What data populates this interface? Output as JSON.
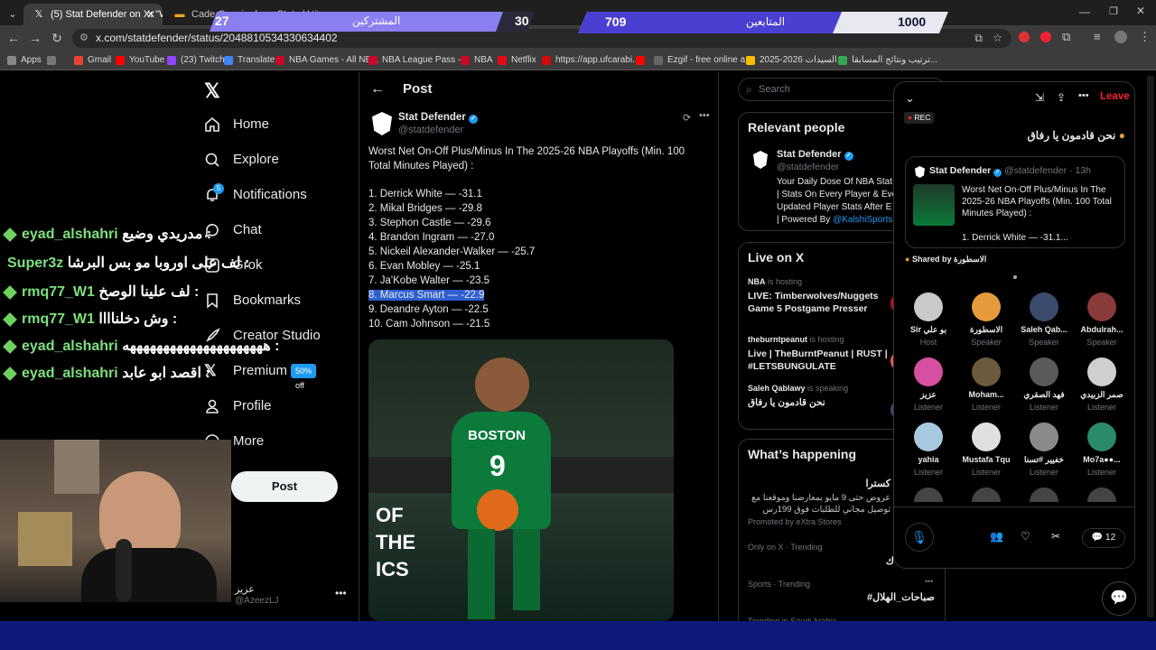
{
  "browser": {
    "tabs": [
      {
        "title": "(5) Stat Defender on X: \"Wo",
        "active": true
      },
      {
        "title": "Cade Cunningham Stats Using...",
        "active": false
      }
    ],
    "url": "x.com/statdefender/status/2048810534330634402",
    "bookmarks": [
      "Apps",
      "Gmail",
      "YouTube",
      "(23) Twitch",
      "Translate",
      "NBA Games - All NB...",
      "NBA League Pass -...",
      "NBA",
      "Netflix",
      "https://app.ufcarabi...",
      "Ezgif - free online a...",
      "السيدات 2026-2025...",
      "ترتيب ونتائج المسابقا..."
    ]
  },
  "overlay": {
    "subs_label": "المشتركين",
    "subs_current": "27",
    "subs_goal": "30",
    "followers_label": "المتابعين",
    "followers_current": "709",
    "followers_goal": "1000"
  },
  "chat": [
    {
      "user": "eyad_alshahri",
      "msg": "مدريدي وضيع :",
      "diamond": true
    },
    {
      "user": "Super3z",
      "msg": "لف على اوروبا مو بس البرشا :",
      "diamond": false
    },
    {
      "user": "rmq77_W1",
      "msg": "لف علينا الوصخ :",
      "diamond": true
    },
    {
      "user": "rmq77_W1",
      "msg": "وش دخلناااا :",
      "diamond": true
    },
    {
      "user": "eyad_alshahri",
      "msg": "هههههههههههههههههههههه :",
      "diamond": true
    },
    {
      "user": "eyad_alshahri",
      "msg": "اقصد ابو عابد :",
      "diamond": true
    }
  ],
  "sidebar": {
    "items": [
      {
        "label": "Home",
        "icon": "home-icon"
      },
      {
        "label": "Explore",
        "icon": "search-icon"
      },
      {
        "label": "Notifications",
        "icon": "bell-icon",
        "badge": "5"
      },
      {
        "label": "Chat",
        "icon": "chat-icon"
      },
      {
        "label": "Grok",
        "icon": "grok-icon"
      },
      {
        "label": "Bookmarks",
        "icon": "bookmark-icon"
      },
      {
        "label": "Creator Studio",
        "icon": "rocket-icon"
      },
      {
        "label": "Premium",
        "icon": "x-icon"
      },
      {
        "label": "Profile",
        "icon": "user-icon"
      },
      {
        "label": "More",
        "icon": "more-icon"
      }
    ],
    "premium_badge": "50% off",
    "post_label": "Post",
    "account_name": "عزيز",
    "account_handle": "@AzeezLJ"
  },
  "main": {
    "header": "Post",
    "author_name": "Stat Defender",
    "author_handle": "@statdefender",
    "tweet_title": "Worst Net On-Off Plus/Minus In The 2025-26 NBA Playoffs (Min. 100 Total Minutes Played) :",
    "list": [
      "1.  Derrick White  —  -31.1",
      "2.  Mikal Bridges  —  -29.8",
      "3.  Stephon Castle  —  -29.6",
      "4.  Brandon Ingram  —  -27.0",
      "5.  Nickeil Alexander-Walker  —  -25.7",
      "6.  Evan Mobley  —  -25.1",
      "7.  Ja'Kobe Walter  —  -23.5",
      "8.  Marcus Smart  —  -22.9",
      "9.  Deandre Ayton  —  -22.5",
      "10.  Cam Johnson  —  -21.5"
    ],
    "highlighted_index": 7,
    "jersey_text": "BOSTON",
    "jersey_number": "9"
  },
  "right": {
    "search_placeholder": "Search",
    "relevant_title": "Relevant people",
    "rp_name": "Stat Defender",
    "rp_handle": "@statdefender",
    "rp_bio_1": "Your Daily Dose Of NBA Stat",
    "rp_bio_2": "| Stats On Every Player & Eve",
    "rp_bio_3": "Updated Player Stats After E",
    "rp_bio_4": "| Powered By",
    "rp_bio_link": "@KalshiSports",
    "live_title": "Live on X",
    "live": [
      {
        "host": "NBA",
        "status": "is hosting",
        "title": "LIVE: Timberwolves/Nuggets Game 5 Postgame Presser"
      },
      {
        "host": "theburntpeanut",
        "status": "is hosting",
        "title": "Live | TheBurntPeanut | RUST | #LETSBUNGULATE"
      },
      {
        "host": "Saleh Qablawy",
        "status": "is speaking",
        "title": "نحن قادمون يا رفاق"
      }
    ],
    "happening_title": "What’s happening",
    "trend1_name": "كسترا",
    "trend1_desc_1": "عروض حتى 9 مايو بمعارضنا وموقعنا مع",
    "trend1_desc_2": "توصيل مجاني للطلبات فوق 199رس",
    "trend1_promo": "Promoted by eXtra Stores",
    "trend2_ctx": "Only on X · Trending",
    "trend2_name": "ك",
    "trend3_ctx": "Sports · Trending",
    "trend3_name": "#صباحات_الهلال",
    "trend4_ctx": "Trending in Saudi Arabia"
  },
  "space": {
    "leave": "Leave",
    "rec": "REC",
    "title": "نحن قادمون يا رفاق",
    "q_name": "Stat Defender",
    "q_handle": "@statdefender · 13h",
    "q_text": "Worst Net On-Off Plus/Minus In The 2025-26 NBA Playoffs (Min. 100 Total Minutes Played) :",
    "q_item": "1.  Derrick White  —  -31.1...",
    "shared_by": "Shared by",
    "shared_name": "الاسطورة",
    "people": [
      {
        "name": "Sir بو علي",
        "role": "Host",
        "color": "#c9c9c9"
      },
      {
        "name": "الاسطورة",
        "role": "Speaker",
        "color": "#e59a3c"
      },
      {
        "name": "Saleh Qab...",
        "role": "Speaker",
        "color": "#3c4a6e"
      },
      {
        "name": "Abdulrah...",
        "role": "Speaker",
        "color": "#8a3a3a"
      },
      {
        "name": "عزيز",
        "role": "Listener",
        "color": "#d64fa0"
      },
      {
        "name": "Moham...",
        "role": "Listener",
        "color": "#6b5a3c"
      },
      {
        "name": "فهد الصقري",
        "role": "Listener",
        "color": "#5a5a5a"
      },
      {
        "name": "صمر الزبيدي",
        "role": "Listener",
        "color": "#cfcfcf"
      },
      {
        "name": "yahia",
        "role": "Listener",
        "color": "#a8c8e0"
      },
      {
        "name": "Mustafa Tqu",
        "role": "Listener",
        "color": "#e0e0e0"
      },
      {
        "name": "خفيير #تسنا",
        "role": "Listener",
        "color": "#8a8a8a"
      },
      {
        "name": "Mo7a●●...",
        "role": "Listener",
        "color": "#2a8a6a"
      }
    ],
    "reply_count": "12"
  },
  "colors": {
    "accent": "#1d9bf0",
    "leave": "#f4212e",
    "chat_green": "#6dd35e",
    "overlay_purple": "#6b5ce7"
  }
}
